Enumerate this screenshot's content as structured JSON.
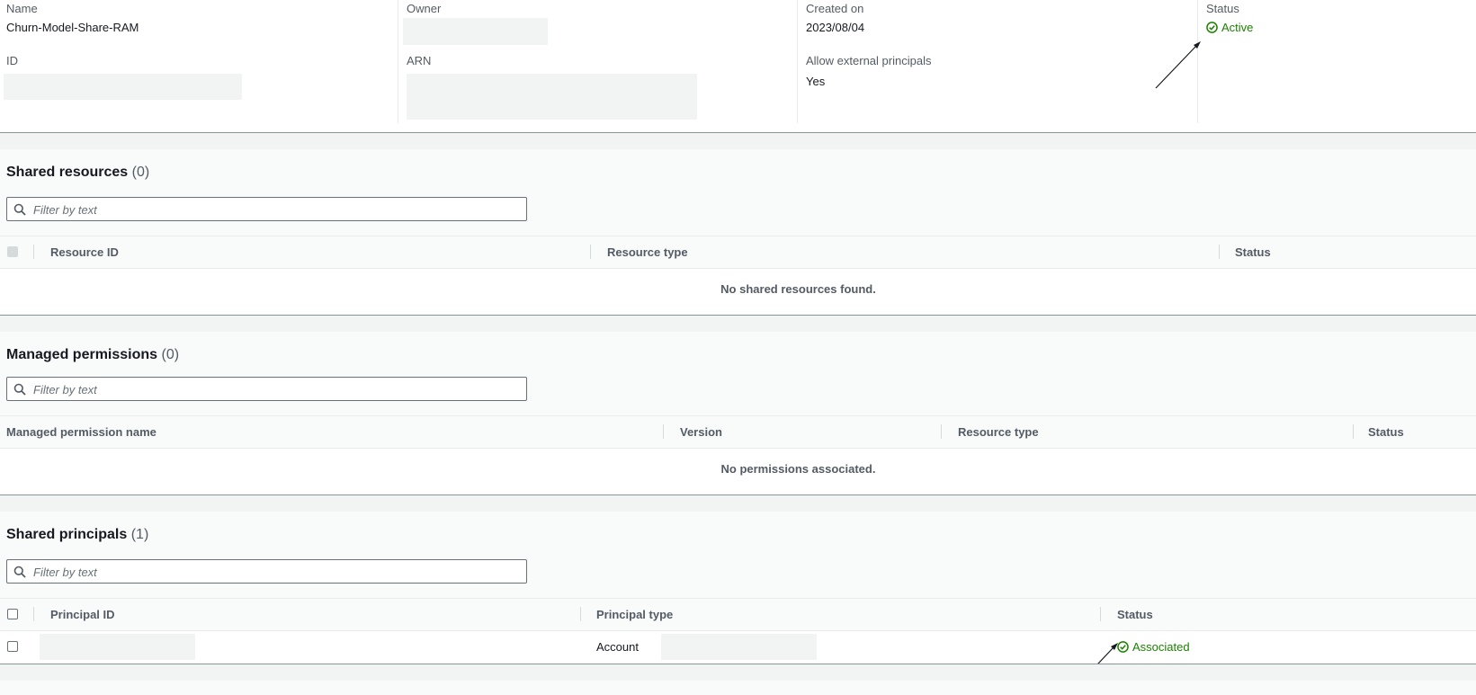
{
  "summary": {
    "name_label": "Name",
    "name_value": "Churn-Model-Share-RAM",
    "owner_label": "Owner",
    "created_label": "Created on",
    "created_value": "2023/08/04",
    "status_label": "Status",
    "status_value": "Active",
    "id_label": "ID",
    "arn_label": "ARN",
    "external_label": "Allow external principals",
    "external_value": "Yes"
  },
  "shared_resources": {
    "title": "Shared resources",
    "count": "(0)",
    "filter_placeholder": "Filter by text",
    "columns": [
      "Resource ID",
      "Resource type",
      "Status"
    ],
    "empty_message": "No shared resources found."
  },
  "managed_permissions": {
    "title": "Managed permissions",
    "count": "(0)",
    "filter_placeholder": "Filter by text",
    "columns": [
      "Managed permission name",
      "Version",
      "Resource type",
      "Status"
    ],
    "empty_message": "No permissions associated."
  },
  "shared_principals": {
    "title": "Shared principals",
    "count": "(1)",
    "filter_placeholder": "Filter by text",
    "columns": [
      "Principal ID",
      "Principal type",
      "Status"
    ],
    "rows": [
      {
        "principal_type": "Account",
        "status": "Associated"
      }
    ]
  },
  "colors": {
    "success": "#1d8102",
    "label": "#545b64",
    "border": "#879596"
  }
}
